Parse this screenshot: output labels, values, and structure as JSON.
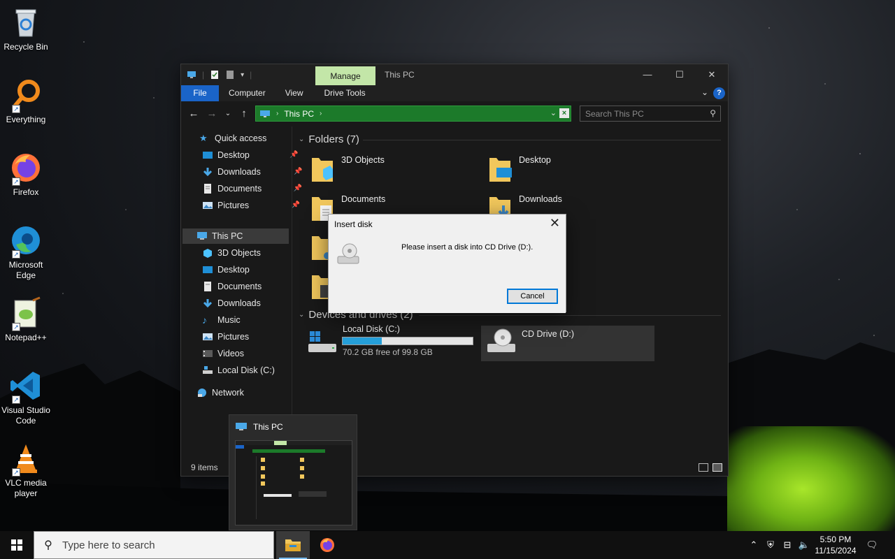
{
  "desktop": {
    "icons": [
      {
        "label": "Recycle Bin",
        "icon": "recycle-bin-icon"
      },
      {
        "label": "Everything",
        "icon": "everything-search-icon"
      },
      {
        "label": "Firefox",
        "icon": "firefox-icon"
      },
      {
        "label": "Microsoft Edge",
        "icon": "edge-icon"
      },
      {
        "label": "Notepad++",
        "icon": "notepadpp-icon"
      },
      {
        "label": "Visual Studio Code",
        "icon": "vscode-icon"
      },
      {
        "label": "VLC media player",
        "icon": "vlc-icon"
      }
    ]
  },
  "explorer": {
    "title": "This PC",
    "manage_tab": "Manage",
    "ribbon_tabs": [
      "File",
      "Computer",
      "View",
      "Drive Tools"
    ],
    "address": {
      "path": "This PC"
    },
    "search_placeholder": "Search This PC",
    "sidebar": {
      "quick_access": "Quick access",
      "quick_items": [
        "Desktop",
        "Downloads",
        "Documents",
        "Pictures"
      ],
      "this_pc": "This PC",
      "pc_items": [
        "3D Objects",
        "Desktop",
        "Documents",
        "Downloads",
        "Music",
        "Pictures",
        "Videos",
        "Local Disk (C:)"
      ],
      "network": "Network"
    },
    "folders_header": "Folders (7)",
    "folders": [
      "3D Objects",
      "Desktop",
      "Documents",
      "Downloads"
    ],
    "devices_header": "Devices and drives (2)",
    "drives": [
      {
        "name": "Local Disk (C:)",
        "free_text": "70.2 GB free of 99.8 GB",
        "used_fraction": 0.3
      },
      {
        "name": "CD Drive (D:)"
      }
    ],
    "status_count": "9 items"
  },
  "dialog": {
    "title": "Insert disk",
    "message": "Please insert a disk into CD Drive (D:).",
    "cancel": "Cancel"
  },
  "thumbnail": {
    "title": "This PC"
  },
  "taskbar": {
    "search_placeholder": "Type here to search",
    "time": "5:50 PM",
    "date": "11/15/2024"
  },
  "colors": {
    "address_bar": "#1c7a2a",
    "manage_tab": "#c3e6a8",
    "file_tab": "#1a64c8",
    "disk_fill": "#26a0da"
  }
}
